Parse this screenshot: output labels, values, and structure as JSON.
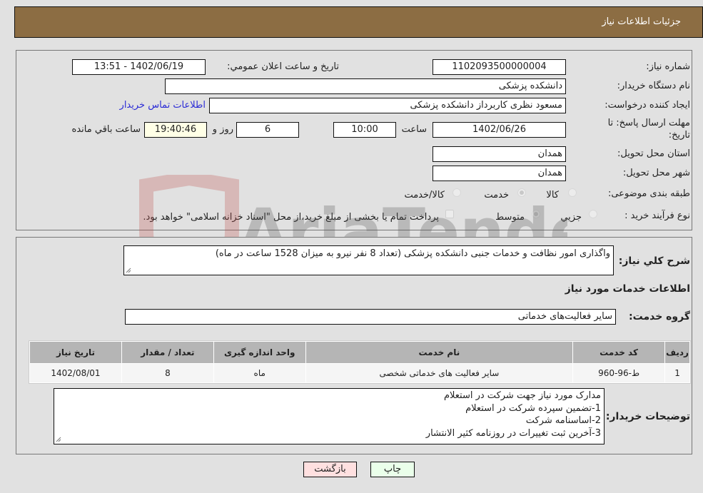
{
  "header": {
    "title": "جزئیات اطلاعات نیاز"
  },
  "form": {
    "need_number_label": "شماره نیاز:",
    "need_number": "1102093500000004",
    "announce_label": "تاریخ و ساعت اعلان عمومي:",
    "announce_value": "1402/06/19 - 13:51",
    "buyer_org_label": "نام دستگاه خريدار:",
    "buyer_org": "دانشکده پزشکی",
    "creator_label": "ایجاد کننده درخواست:",
    "creator": "مسعود نظری کاربرداز دانشکده پزشکی",
    "contact_link": "اطلاعات تماس خریدار",
    "deadline_label_1": "مهلت ارسال پاسخ: تا",
    "deadline_label_2": "تاریخ:",
    "deadline_date": "1402/06/26",
    "time_label": "ساعت",
    "deadline_time": "10:00",
    "days_value": "6",
    "days_label": "روز و",
    "remaining_time": "19:40:46",
    "remaining_label": "ساعت باقي مانده",
    "province_label": "استان محل تحویل:",
    "province": "همدان",
    "city_label": "شهر محل تحویل:",
    "city": "همدان",
    "category_label": "طبقه بندی موضوعی:",
    "category_options": [
      {
        "label": "کالا",
        "checked": false
      },
      {
        "label": "خدمت",
        "checked": true
      },
      {
        "label": "کالا/خدمت",
        "checked": false
      }
    ],
    "process_label": "نوع فرآیند خرید :",
    "process_options": [
      {
        "label": "جزيي",
        "checked": false
      },
      {
        "label": "متوسط",
        "checked": true
      }
    ],
    "treasury_note": "پرداخت تمام یا بخشی از مبلغ خرید،از محل \"اسناد خزانه اسلامی\" خواهد بود.",
    "treasury_checked": false
  },
  "details": {
    "description_label": "شرح کلي نياز:",
    "description": "واگذاری امور نظافت و خدمات جنبی دانشکده پزشکی (تعداد 8 نفر نیرو به میزان 1528 ساعت در ماه)",
    "services_heading": "اطلاعات خدمات مورد نیاز",
    "service_group_label": "گروه خدمت:",
    "service_group": "سایر فعالیت‌های خدماتی",
    "table": {
      "columns": [
        "ردیف",
        "کد خدمت",
        "نام خدمت",
        "واحد اندازه گیری",
        "تعداد / مقدار",
        "تاریخ نیاز"
      ],
      "rows": [
        [
          "1",
          "ط-96-960",
          "سایر فعالیت های خدماتی شخصی",
          "ماه",
          "8",
          "1402/08/01"
        ]
      ]
    },
    "buyer_notes_label": "توضیحات خریدار:",
    "buyer_notes": [
      "مدارک مورد نیاز جهت شرکت در استعلام",
      "1-تضمین سپرده شرکت در استعلام",
      "2-اساسنامه شرکت",
      "3-آخرین ثبت تغییرات در روزنامه کثیر الانتشار"
    ]
  },
  "buttons": {
    "print": "چاپ",
    "back": "بازگشت"
  },
  "watermark": {
    "text": "AriaTender.neT"
  },
  "colors": {
    "header_bg": "#8c6d43",
    "print_bg": "#eaffea",
    "back_bg": "#ffe0e0",
    "link": "#2b2bd6"
  }
}
